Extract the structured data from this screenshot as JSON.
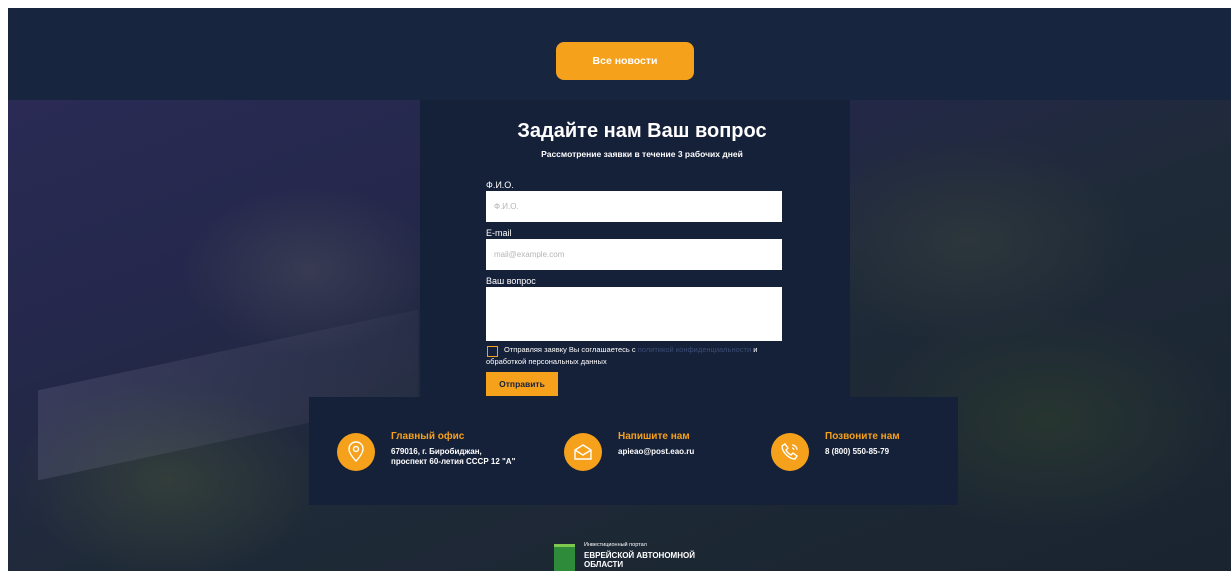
{
  "header": {
    "all_news_button": "Все новости"
  },
  "form": {
    "title": "Задайте нам Ваш вопрос",
    "subtitle": "Рассмотрение заявки в течение 3 рабочих дней",
    "name_label": "Ф.И.О.",
    "name_placeholder": "Ф.И.О.",
    "email_label": "E-mail",
    "email_placeholder": "mail@example.com",
    "question_label": "Ваш вопрос",
    "consent_prefix": "Отправляя заявку Вы соглашаетесь с ",
    "consent_link": "политикой конфиденциальности",
    "consent_suffix": " и обработкой персональных данных",
    "submit_label": "Отправить"
  },
  "contacts": [
    {
      "title": "Главный офис",
      "line1": "679016, г. Биробиджан,",
      "line2": "проспект 60-летия СССР 12 \"А\"",
      "icon": "location-pin-icon"
    },
    {
      "title": "Напишите нам",
      "line1": "apieao@post.eao.ru",
      "line2": "",
      "icon": "envelope-icon"
    },
    {
      "title": "Позвоните нам",
      "line1": "8 (800) 550-85-79",
      "line2": "",
      "icon": "phone-icon"
    }
  ],
  "footer": {
    "logo_small_text": "Инвестиционный портал",
    "logo_big_text": "ЕВРЕЙСКОЙ АВТОНОМНОЙ ОБЛАСТИ"
  },
  "colors": {
    "accent": "#f5a11c",
    "panel": "#152039",
    "link": "#3b4d74"
  }
}
